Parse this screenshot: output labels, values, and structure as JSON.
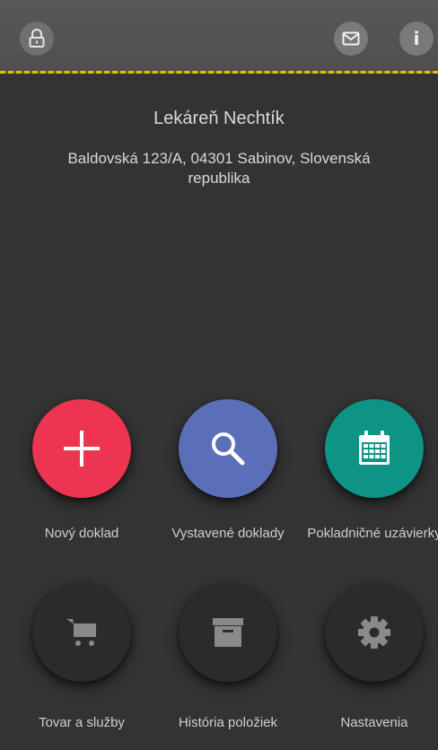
{
  "header": {
    "icons": {
      "lock": "lock-icon",
      "mail": "mail-icon",
      "info": "info-icon"
    },
    "accent_color": "#e3c000"
  },
  "store": {
    "name": "Lekáreň Nechtík",
    "address": "Baldovská 123/A, 04301 Sabinov, Slovenská republika"
  },
  "menu": [
    {
      "label": "Nový doklad",
      "icon": "plus-icon",
      "color": "#ed3450"
    },
    {
      "label": "Vystavené doklady",
      "icon": "search-icon",
      "color": "#5a6fb8"
    },
    {
      "label": "Pokladničné uzávierky",
      "icon": "calendar-icon",
      "color": "#0d9484"
    },
    {
      "label": "Tovar a služby",
      "icon": "cart-icon",
      "color": "#2b2b2b"
    },
    {
      "label": "História položiek",
      "icon": "archive-box-icon",
      "color": "#2b2b2b"
    },
    {
      "label": "Nastavenia",
      "icon": "gear-icon",
      "color": "#2b2b2b"
    }
  ]
}
